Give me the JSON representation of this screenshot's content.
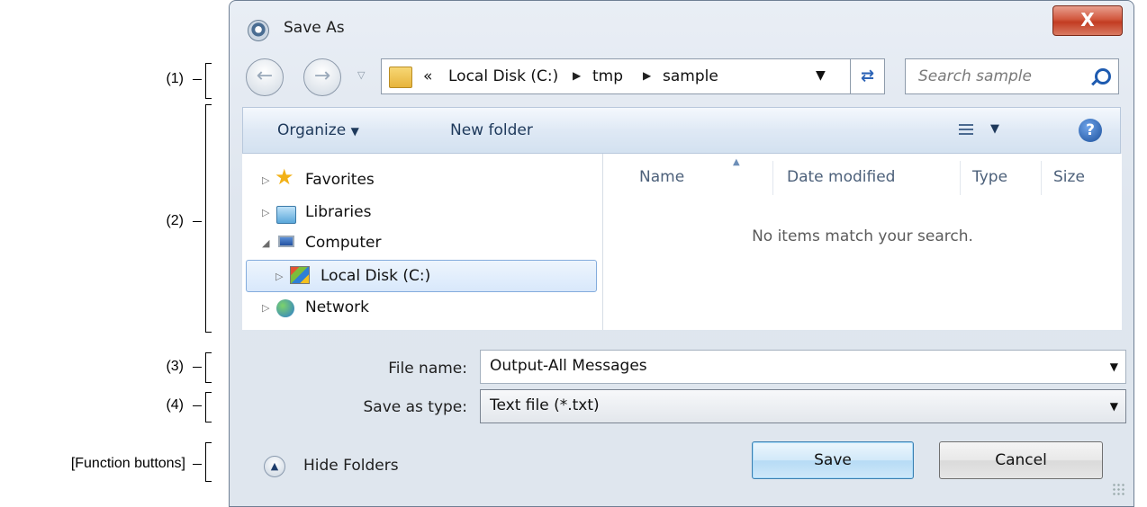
{
  "callouts": {
    "c1": "(1)",
    "c2": "(2)",
    "c3": "(3)",
    "c4": "(4)",
    "c5": "[Function buttons]"
  },
  "dialog": {
    "title": "Save As",
    "close_glyph": "X"
  },
  "address": {
    "overflow": "«",
    "crumbs": [
      "Local Disk (C:)",
      "tmp",
      "sample"
    ],
    "search_placeholder": "Search sample"
  },
  "toolbar": {
    "organize": "Organize",
    "new_folder": "New folder",
    "help_glyph": "?"
  },
  "nav_tree": {
    "favorites": "Favorites",
    "libraries": "Libraries",
    "computer": "Computer",
    "local_disk": "Local Disk (C:)",
    "network": "Network"
  },
  "file_list": {
    "columns": [
      "Name",
      "Date modified",
      "Type",
      "Size"
    ],
    "empty_message": "No items match your search."
  },
  "form": {
    "file_name_label": "File name:",
    "file_name_value": "Output-All Messages",
    "type_label": "Save as type:",
    "type_value": "Text file (*.txt)"
  },
  "footer": {
    "hide_folders": "Hide Folders",
    "save": "Save",
    "cancel": "Cancel"
  },
  "icons": {
    "title": "app-icon",
    "folder": "folder-icon",
    "refresh": "refresh-icon",
    "search": "search-icon",
    "views": "views-icon",
    "help": "help-icon"
  },
  "colors": {
    "close_button": "#c23c22",
    "save_button_border": "#3c7fb1",
    "toolbar_text": "#1e395b",
    "selection_border": "#84acdd"
  }
}
